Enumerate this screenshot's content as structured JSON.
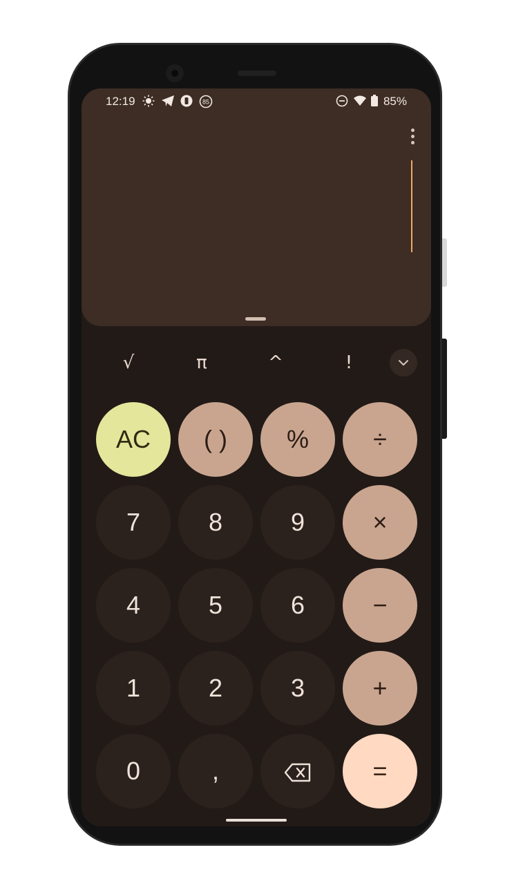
{
  "status_bar": {
    "time": "12:19",
    "battery_percent": "85%",
    "notification_badge": "85",
    "icons": [
      "brightness-icon",
      "telegram-icon",
      "app-icon",
      "badge-icon",
      "dnd-icon",
      "wifi-icon",
      "battery-icon"
    ]
  },
  "display": {
    "expression": "",
    "cursor_color": "#f0a86a"
  },
  "scientific_row": {
    "keys": [
      "√",
      "π",
      "^",
      "!"
    ],
    "expand_icon": "chevron-down-icon"
  },
  "keypad": {
    "row1": [
      "AC",
      "( )",
      "%",
      "÷"
    ],
    "row2": [
      "7",
      "8",
      "9",
      "×"
    ],
    "row3": [
      "4",
      "5",
      "6",
      "−"
    ],
    "row4": [
      "1",
      "2",
      "3",
      "+"
    ],
    "row5": [
      "0",
      ",",
      "",
      "="
    ],
    "backspace_icon": "backspace-icon"
  },
  "colors": {
    "display_bg": "#3d2d25",
    "keypad_bg": "#221a16",
    "number_key": "#2c221d",
    "operator_key": "#c9a590",
    "clear_key": "#e4e69b",
    "equals_key": "#ffd9c2"
  }
}
